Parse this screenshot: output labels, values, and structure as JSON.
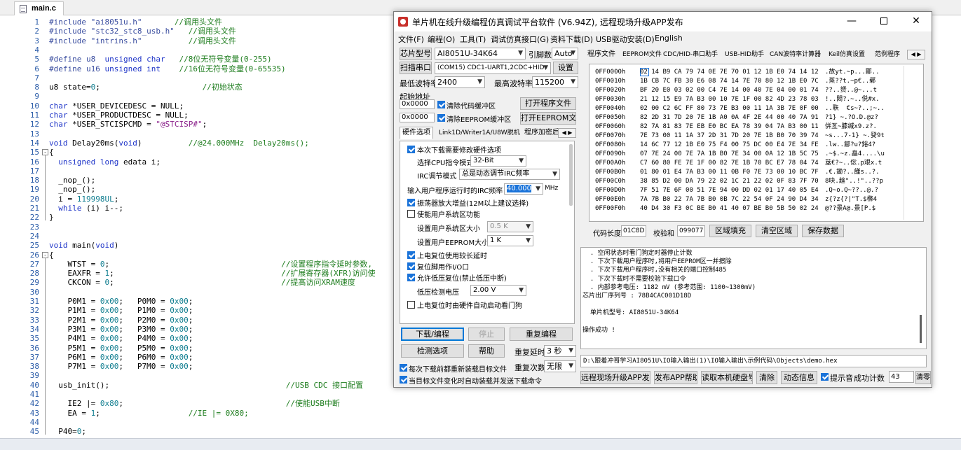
{
  "editor": {
    "tab_label": "main.c",
    "lines": [
      {
        "n": "1",
        "parts": [
          [
            "pp",
            "#include \"ai8051u.h\""
          ],
          [
            "",
            "       "
          ],
          [
            "cm",
            "//调用头文件"
          ]
        ]
      },
      {
        "n": "2",
        "parts": [
          [
            "pp",
            "#include \"stc32_stc8_usb.h\""
          ],
          [
            "",
            "   "
          ],
          [
            "cm",
            "//调用头文件"
          ]
        ]
      },
      {
        "n": "3",
        "parts": [
          [
            "pp",
            "#include \"intrins.h\""
          ],
          [
            "",
            "          "
          ],
          [
            "cm",
            "//调用头文件"
          ]
        ]
      },
      {
        "n": "4",
        "parts": []
      },
      {
        "n": "5",
        "parts": [
          [
            "pp",
            "#define u8  "
          ],
          [
            "kw",
            "unsigned char"
          ],
          [
            "",
            "   "
          ],
          [
            "cm",
            "//8位无符号变量(0-255)"
          ]
        ]
      },
      {
        "n": "6",
        "parts": [
          [
            "pp",
            "#define u16 "
          ],
          [
            "kw",
            "unsigned int"
          ],
          [
            "",
            "    "
          ],
          [
            "cm",
            "//16位无符号变量(0-65535)"
          ]
        ]
      },
      {
        "n": "7",
        "parts": []
      },
      {
        "n": "8",
        "parts": [
          [
            "",
            "u8 state="
          ],
          [
            "num",
            "0"
          ],
          [
            "",
            ";                      "
          ],
          [
            "cm",
            "//初始状态"
          ]
        ]
      },
      {
        "n": "9",
        "parts": []
      },
      {
        "n": "10",
        "parts": [
          [
            "kw",
            "char"
          ],
          [
            "",
            " *USER_DEVICEDESC = NULL;"
          ]
        ]
      },
      {
        "n": "11",
        "parts": [
          [
            "kw",
            "char"
          ],
          [
            "",
            " *USER_PRODUCTDESC = NULL;"
          ]
        ]
      },
      {
        "n": "12",
        "parts": [
          [
            "kw",
            "char"
          ],
          [
            "",
            " *USER_STCISPCMD = "
          ],
          [
            "str",
            "\"@STCISP#\""
          ],
          [
            "",
            ";"
          ]
        ]
      },
      {
        "n": "13",
        "parts": []
      },
      {
        "n": "14",
        "parts": [
          [
            "kw",
            "void"
          ],
          [
            "",
            " Delay20ms("
          ],
          [
            "kw",
            "void"
          ],
          [
            "",
            ")          "
          ],
          [
            "cm",
            "//@24.000MHz  Delay20ms();"
          ]
        ]
      },
      {
        "n": "15",
        "fold": "-",
        "parts": [
          [
            "",
            "{"
          ]
        ]
      },
      {
        "n": "16",
        "parts": [
          [
            "",
            "  "
          ],
          [
            "kw",
            "unsigned long"
          ],
          [
            "",
            " edata i;"
          ]
        ]
      },
      {
        "n": "17",
        "parts": []
      },
      {
        "n": "18",
        "parts": [
          [
            "",
            "  _nop_();"
          ]
        ]
      },
      {
        "n": "19",
        "parts": [
          [
            "",
            "  _nop_();"
          ]
        ]
      },
      {
        "n": "20",
        "parts": [
          [
            "",
            "  i = "
          ],
          [
            "num",
            "119998UL"
          ],
          [
            "",
            ";"
          ]
        ]
      },
      {
        "n": "21",
        "parts": [
          [
            "",
            "  "
          ],
          [
            "kw",
            "while"
          ],
          [
            "",
            " (i) i--;"
          ]
        ]
      },
      {
        "n": "22",
        "parts": [
          [
            "",
            "}"
          ]
        ]
      },
      {
        "n": "23",
        "parts": []
      },
      {
        "n": "24",
        "parts": []
      },
      {
        "n": "25",
        "parts": [
          [
            "kw",
            "void"
          ],
          [
            "",
            " main("
          ],
          [
            "kw",
            "void"
          ],
          [
            "",
            ")"
          ]
        ]
      },
      {
        "n": "26",
        "fold": "-",
        "parts": [
          [
            "",
            "{"
          ]
        ]
      },
      {
        "n": "27",
        "parts": [
          [
            "",
            "    WTST = "
          ],
          [
            "num",
            "0"
          ],
          [
            "",
            ";                                     "
          ],
          [
            "cm",
            "//设置程序指令延时参数,"
          ]
        ]
      },
      {
        "n": "28",
        "parts": [
          [
            "",
            "    EAXFR = "
          ],
          [
            "num",
            "1"
          ],
          [
            "",
            ";                                    "
          ],
          [
            "cm",
            "//扩展寄存器(XFR)访问使"
          ]
        ]
      },
      {
        "n": "29",
        "parts": [
          [
            "",
            "    CKCON = "
          ],
          [
            "num",
            "0"
          ],
          [
            "",
            ";                                    "
          ],
          [
            "cm",
            "//提高访问XRAM速度"
          ]
        ]
      },
      {
        "n": "30",
        "parts": []
      },
      {
        "n": "31",
        "parts": [
          [
            "",
            "    P0M1 = "
          ],
          [
            "num",
            "0x00"
          ],
          [
            "",
            ";   P0M0 = "
          ],
          [
            "num",
            "0x00"
          ],
          [
            "",
            ";"
          ]
        ]
      },
      {
        "n": "32",
        "parts": [
          [
            "",
            "    P1M1 = "
          ],
          [
            "num",
            "0x00"
          ],
          [
            "",
            ";   P1M0 = "
          ],
          [
            "num",
            "0x00"
          ],
          [
            "",
            ";"
          ]
        ]
      },
      {
        "n": "33",
        "parts": [
          [
            "",
            "    P2M1 = "
          ],
          [
            "num",
            "0x00"
          ],
          [
            "",
            ";   P2M0 = "
          ],
          [
            "num",
            "0x00"
          ],
          [
            "",
            ";"
          ]
        ]
      },
      {
        "n": "34",
        "parts": [
          [
            "",
            "    P3M1 = "
          ],
          [
            "num",
            "0x00"
          ],
          [
            "",
            ";   P3M0 = "
          ],
          [
            "num",
            "0x00"
          ],
          [
            "",
            ";"
          ]
        ]
      },
      {
        "n": "35",
        "parts": [
          [
            "",
            "    P4M1 = "
          ],
          [
            "num",
            "0x00"
          ],
          [
            "",
            ";   P4M0 = "
          ],
          [
            "num",
            "0x00"
          ],
          [
            "",
            ";"
          ]
        ]
      },
      {
        "n": "36",
        "parts": [
          [
            "",
            "    P5M1 = "
          ],
          [
            "num",
            "0x00"
          ],
          [
            "",
            ";   P5M0 = "
          ],
          [
            "num",
            "0x00"
          ],
          [
            "",
            ";"
          ]
        ]
      },
      {
        "n": "37",
        "parts": [
          [
            "",
            "    P6M1 = "
          ],
          [
            "num",
            "0x00"
          ],
          [
            "",
            ";   P6M0 = "
          ],
          [
            "num",
            "0x00"
          ],
          [
            "",
            ";"
          ]
        ]
      },
      {
        "n": "38",
        "parts": [
          [
            "",
            "    P7M1 = "
          ],
          [
            "num",
            "0x00"
          ],
          [
            "",
            ";   P7M0 = "
          ],
          [
            "num",
            "0x00"
          ],
          [
            "",
            ";"
          ]
        ]
      },
      {
        "n": "39",
        "parts": []
      },
      {
        "n": "40",
        "parts": [
          [
            "",
            "  usb_init();                                      "
          ],
          [
            "cm",
            "//USB CDC 接口配置"
          ]
        ]
      },
      {
        "n": "41",
        "parts": []
      },
      {
        "n": "42",
        "parts": [
          [
            "",
            "    IE2 |= "
          ],
          [
            "num",
            "0x80"
          ],
          [
            "",
            ";                                   "
          ],
          [
            "cm",
            "//使能USB中断"
          ]
        ]
      },
      {
        "n": "43",
        "parts": [
          [
            "",
            "    EA = "
          ],
          [
            "num",
            "1"
          ],
          [
            "",
            ";                   "
          ],
          [
            "cm",
            "//IE |= 0X80;"
          ]
        ]
      },
      {
        "n": "44",
        "parts": []
      },
      {
        "n": "45",
        "parts": [
          [
            "",
            "  P40="
          ],
          [
            "num",
            "0"
          ],
          [
            "",
            ";"
          ]
        ]
      }
    ]
  },
  "dialog": {
    "title": "单片机在线升级编程仿真调试平台软件 (V6.94Z), 远程现场升级APP发布",
    "window_controls": {
      "minimize": "—",
      "close": "✕"
    },
    "menu": [
      "文件(F)",
      "编程(O)",
      "工具(T)",
      "调试仿真接口(G)",
      "资料下载(D)",
      "USB驱动安装(D)",
      "English"
    ],
    "chip_label": "芯片型号",
    "chip_value": "AI8051U-34K64",
    "pin_label": "引脚数",
    "pin_value": "Auto",
    "scan_button": "扫描串口",
    "port_value": "(COM15) CDC1-UART1,2CDC+HID",
    "settings_button": "设置",
    "min_baud_label": "最低波特率",
    "min_baud_value": "2400",
    "max_baud_label": "最高波特率",
    "max_baud_value": "115200",
    "start_addr_label": "起始地址",
    "addr1_value": "0x0000",
    "clear_code_label": "清除代码缓冲区",
    "open_program_button": "打开程序文件",
    "addr2_value": "0x0000",
    "clear_eeprom_label": "清除EEPROM缓冲区",
    "open_eeprom_button": "打开EEPROM文件",
    "left_tabs": [
      "硬件选项",
      "Link1D/Writer1A/U8W脱机",
      "程序加密后"
    ],
    "hw": {
      "modify_hw_label": "本次下载需要修改硬件选项",
      "cpu_mode_label": "选择CPU指令模式",
      "cpu_mode_value": "32-Bit",
      "irc_mode_label": "IRC调节模式",
      "irc_mode_value": "总是动态调节IRC频率",
      "irc_freq_label": "输入用户程序运行时的IRC频率",
      "irc_freq_value": "40.000",
      "irc_unit": "MHz",
      "osc_gain_label": "振荡器放大增益(12M以上建议选择)",
      "user_sys_label": "使能用户系统区功能",
      "user_sys_size_label": "设置用户系统区大小",
      "user_sys_size_value": "0.5 K",
      "user_eeprom_label": "设置用户EEPROM大小",
      "user_eeprom_value": "1   K",
      "long_reset_label": "上电复位使用较长延时",
      "reset_pin_label": "复位脚用作I/O口",
      "lvd_reset_label": "允许低压复位(禁止低压中断)",
      "lvd_voltage_label": "低压检测电压",
      "lvd_voltage_value": "2.00 V",
      "wdt_label": "上电复位时由硬件自动启动看门狗"
    },
    "download_button": "下载/编程",
    "stop_button": "停止",
    "reprogram_button": "重复编程",
    "check_button": "检测选项",
    "help_button": "帮助",
    "repeat_delay_label": "重复延时",
    "repeat_delay_value": "3 秒",
    "repeat_count_label": "重复次数",
    "repeat_count_value": "无限",
    "reload_label": "每次下载前都重新装载目标文件",
    "auto_send_label": "当目标文件变化时自动装载并发送下载命令",
    "right_tabs": [
      "程序文件",
      "EEPROM文件",
      "CDC/HID-串口助手",
      "USB-HID助手",
      "CAN波特率计算器",
      "Keil仿真设置",
      "范例程序"
    ],
    "hex_rows": [
      {
        "addr": "0FF0000h",
        "bytes": "02 14 B9 CA 79 74 0E 7E 70 01 12 1B E0 74 14 12",
        "ascii": ".故yt.~p...鄑.."
      },
      {
        "addr": "0FF0010h",
        "bytes": "1B CB 7C FB 30 E6 08 74 14 7E 70 80 12 1B E0 7C",
        "ascii": ".蒸??t.~p€..鄵"
      },
      {
        "addr": "0FF0020h",
        "bytes": "BF 20 E0 03 02 00 C4 7E 14 00 40 7E 04 00 01 74",
        "ascii": "??..赟..@~...t"
      },
      {
        "addr": "0FF0030h",
        "bytes": "21 12 15 E9 7A B3 00 10 7E 1F 00 82 4D 23 78 03",
        "ascii": "!..閦?.~..侻#x."
      },
      {
        "addr": "0FF0040h",
        "bytes": "02 00 C2 6C FF 80 73 7E B3 00 11 1A 3B 7E 0F 00",
        "ascii": "..聅  €s~?..;~.."
      },
      {
        "addr": "0FF0050h",
        "bytes": "82 2D 31 7D 20 7E 1B A0 0A 4F 2E 44 00 40 7A 91",
        "ascii": "?1} ~.?O.D.@z?"
      },
      {
        "addr": "0FF0060h",
        "bytes": "82 7A 81 83 7E EB E0 BC EA 78 39 04 7A B3 00 11",
        "ascii": "倂亙~膝缄x9.z?."
      },
      {
        "addr": "0FF0070h",
        "bytes": "7E 73 00 11 1A 37 2D 31 7D 20 7E 1B B0 70 39 74",
        "ascii": "~s...7-1} ~.癹9t"
      },
      {
        "addr": "0FF0080h",
        "bytes": "14 6C 77 12 1B E0 75 F4 00 75 DC 00 E4 7E 34 FE",
        "ascii": ".lw..鄒?u?鋊4?"
      },
      {
        "addr": "0FF0090h",
        "bytes": "07 7E 24 00 7E 7A 1B B0 7E 34 00 0A 12 1B 5C 75",
        "ascii": ".~$.~z.皛4....\\u"
      },
      {
        "addr": "0FF00A0h",
        "bytes": "C7 60 80 FE 7E 1F 00 82 7E 1B 70 BC E7 78 04 74",
        "ascii": "莁€?~..倊.p艰x.t"
      },
      {
        "addr": "0FF00B0h",
        "bytes": "01 80 01 E4 7A B3 00 11 0B F0 7E 73 00 10 BC 7F",
        "ascii": ".€.鋤?..饉s..?."
      },
      {
        "addr": "0FF00C0h",
        "bytes": "38 85 D2 00 DA 79 22 02 1C 21 22 02 0F 83 7F 70",
        "ascii": "8吷.趛\"..!\"..??p"
      },
      {
        "addr": "0FF00D0h",
        "bytes": "7F 51 7E 6F 00 51 7E 94 00 DD 02 01 17 40 05 E4",
        "ascii": ".Q~o.Q~??..@.?"
      },
      {
        "addr": "0FF00E0h",
        "bytes": "7A 7B B0 22 7A 7B B0 0B 7C 22 54 0F 24 90 D4 34",
        "ascii": "z{?z{?|\"T.$樤4"
      },
      {
        "addr": "0FF00F0h",
        "bytes": "40 D4 30 F3 0C BE B0 41 40 07 BE B0 5B 50 02 24",
        "ascii": "@??景A@.景[P.$"
      }
    ],
    "code_len_label": "代码长度",
    "code_len_value": "01C8D",
    "checksum_label": "校验和",
    "checksum_value": "099077",
    "fill_button": "区域填充",
    "clear_button": "清空区域",
    "save_button": "保存数据",
    "log_lines": [
      "  . 空闲状态时看门狗定时器停止计数",
      "  . 下次下载用户程序时,将用户EEPROM区一并擦除",
      "  . 下次下载用户程序时,没有相关的端口控制485",
      "  . 下次下载时不需要校验下载口令",
      "  . 内部参考电压: 1182 mV (参考范围: 1100~1300mV)",
      "芯片出厂序列号 : 78B4CAC001D18D",
      "",
      "  单片机型号: AI8051U-34K64",
      "",
      "操作成功 !"
    ],
    "path_value": "D:\\跟着冲哥学习AI8051U\\IO输入输出(1)\\IO输入输出\\示例代码\\Objects\\demo.hex",
    "bottom": {
      "publish_button": "远程现场升级APP发布",
      "publish_help_button": "发布APP帮助",
      "read_disk_button": "读取本机硬盘号",
      "clear_button": "清除",
      "dynamic_button": "动态信息",
      "sound_label": "提示音",
      "success_label": "成功计数",
      "success_value": "43",
      "clear2_button": "清零"
    },
    "colors": {
      "accent": "#1a73d9",
      "app_icon": "#c8302b"
    }
  }
}
